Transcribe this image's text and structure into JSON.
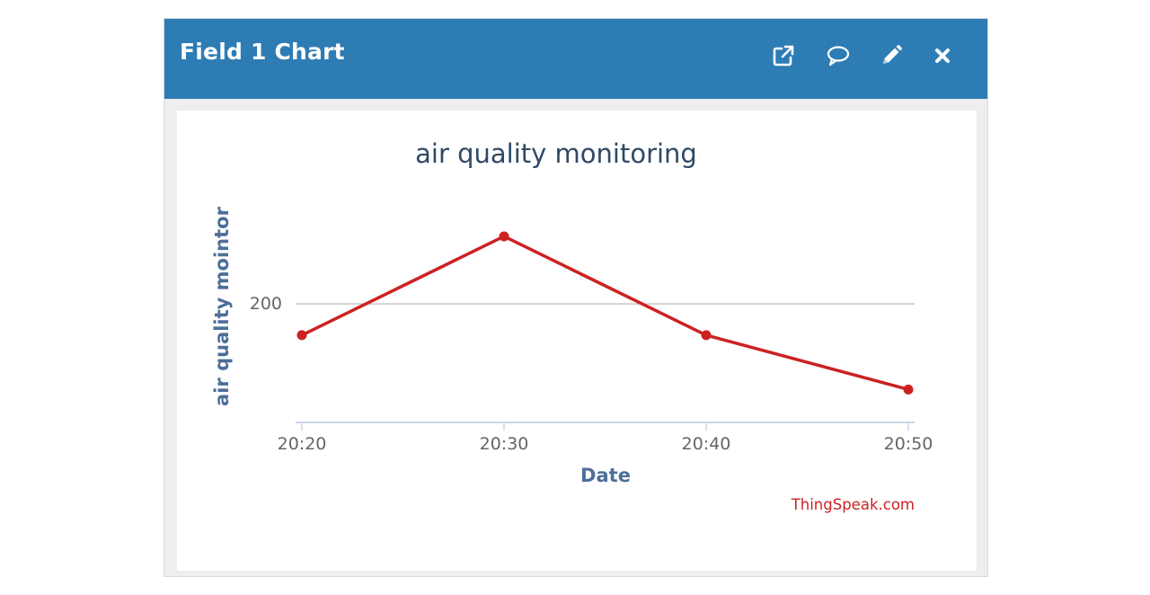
{
  "widget": {
    "title": "Field 1 Chart",
    "buttons": [
      {
        "name": "open-external-button",
        "icon": "external-link-icon"
      },
      {
        "name": "comment-button",
        "icon": "comment-icon"
      },
      {
        "name": "edit-button",
        "icon": "pencil-icon"
      },
      {
        "name": "close-button",
        "icon": "close-icon"
      }
    ]
  },
  "colors": {
    "header": "#2e7cb4",
    "series": "#cc2222",
    "axis_title": "#4d6e9a",
    "credit": "#cc2222"
  },
  "chart_data": {
    "type": "line",
    "title": "air quality monitoring",
    "xlabel": "Date",
    "ylabel": "air quality mointor",
    "x": [
      "20:20",
      "20:30",
      "20:40",
      "20:50"
    ],
    "x_ticks": [
      "20:20",
      "20:30",
      "20:40",
      "20:50"
    ],
    "y_ticks": [
      200
    ],
    "ylim": [
      128,
      271
    ],
    "grid": true,
    "legend": "none",
    "series": [
      {
        "values": [
          181,
          241,
          181,
          148
        ]
      }
    ],
    "credit": "ThingSpeak.com"
  }
}
